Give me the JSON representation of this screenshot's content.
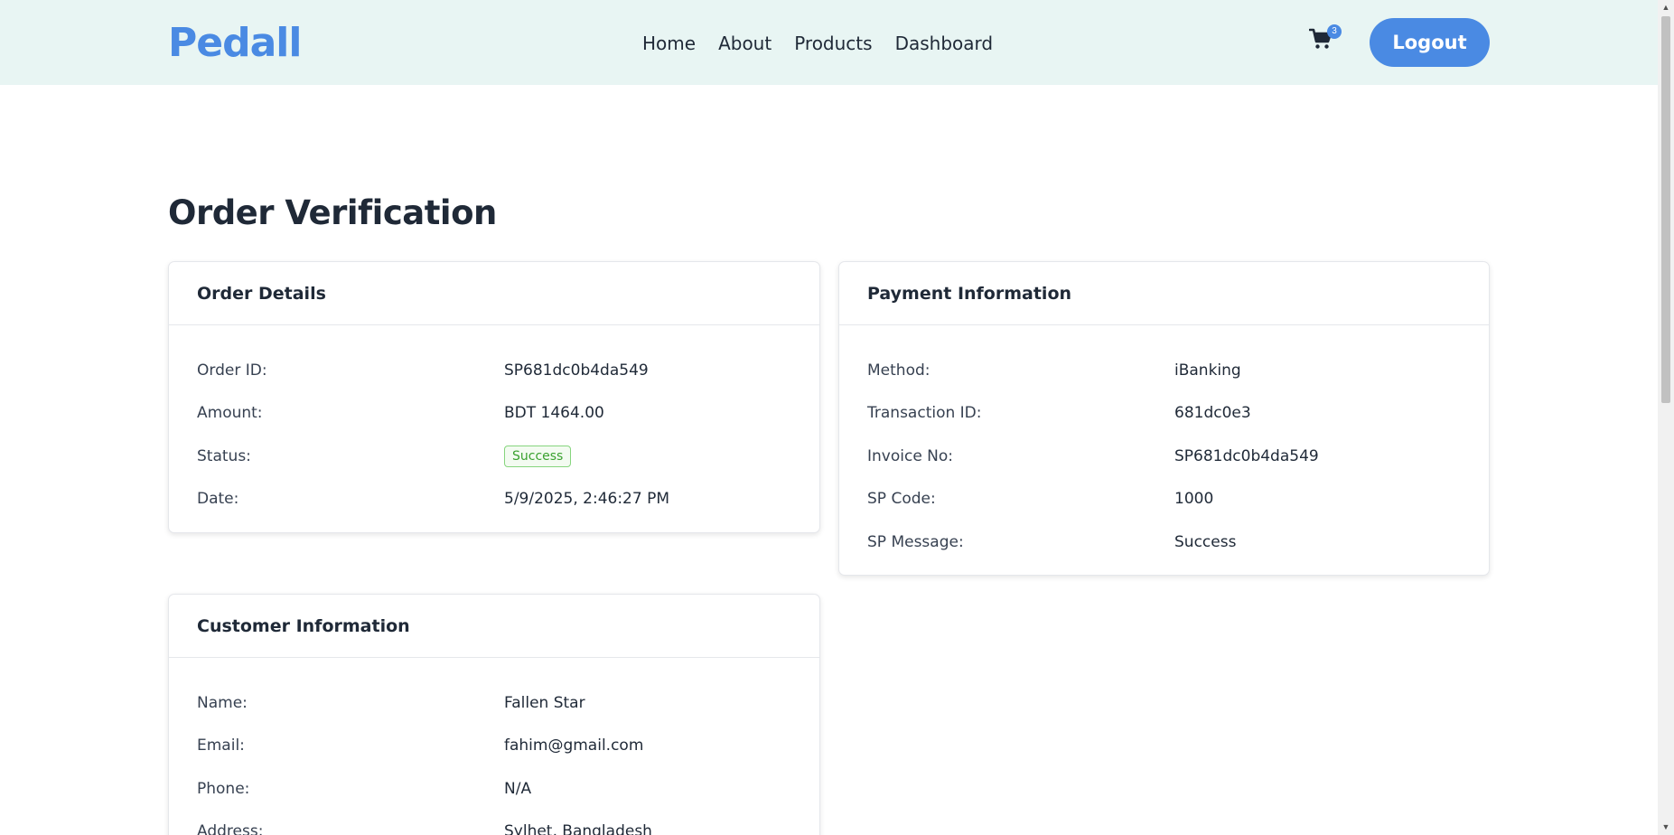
{
  "navbar": {
    "logo": "Pedall",
    "links": [
      "Home",
      "About",
      "Products",
      "Dashboard"
    ],
    "cart_count": "3",
    "logout_label": "Logout",
    "accent_color": "#4a8ae3",
    "background_color": "#e8f5f3"
  },
  "page": {
    "title": "Order Verification"
  },
  "order_details": {
    "title": "Order Details",
    "rows": [
      {
        "label": "Order ID:",
        "value": "SP681dc0b4da549"
      },
      {
        "label": "Amount:",
        "value": "BDT 1464.00"
      },
      {
        "label": "Status:",
        "value": "Success"
      },
      {
        "label": "Date:",
        "value": "5/9/2025, 2:46:27 PM"
      }
    ]
  },
  "payment_information": {
    "title": "Payment Information",
    "rows": [
      {
        "label": "Method:",
        "value": "iBanking"
      },
      {
        "label": "Transaction ID:",
        "value": "681dc0e3"
      },
      {
        "label": "Invoice No:",
        "value": "SP681dc0b4da549"
      },
      {
        "label": "SP Code:",
        "value": "1000"
      },
      {
        "label": "SP Message:",
        "value": "Success"
      }
    ]
  },
  "customer_information": {
    "title": "Customer Information",
    "rows": [
      {
        "label": "Name:",
        "value": "Fallen Star"
      },
      {
        "label": "Email:",
        "value": "fahim@gmail.com"
      },
      {
        "label": "Phone:",
        "value": "N/A"
      },
      {
        "label": "Address:",
        "value": "Sylhet, Bangladesh"
      }
    ]
  },
  "icons": {
    "cart": "cart-icon",
    "scroll_up": "scroll-up-arrow-icon",
    "scroll_down": "scroll-down-arrow-icon"
  },
  "status_colors": {
    "success_text": "#3aa12f",
    "success_border": "#86d57e"
  }
}
